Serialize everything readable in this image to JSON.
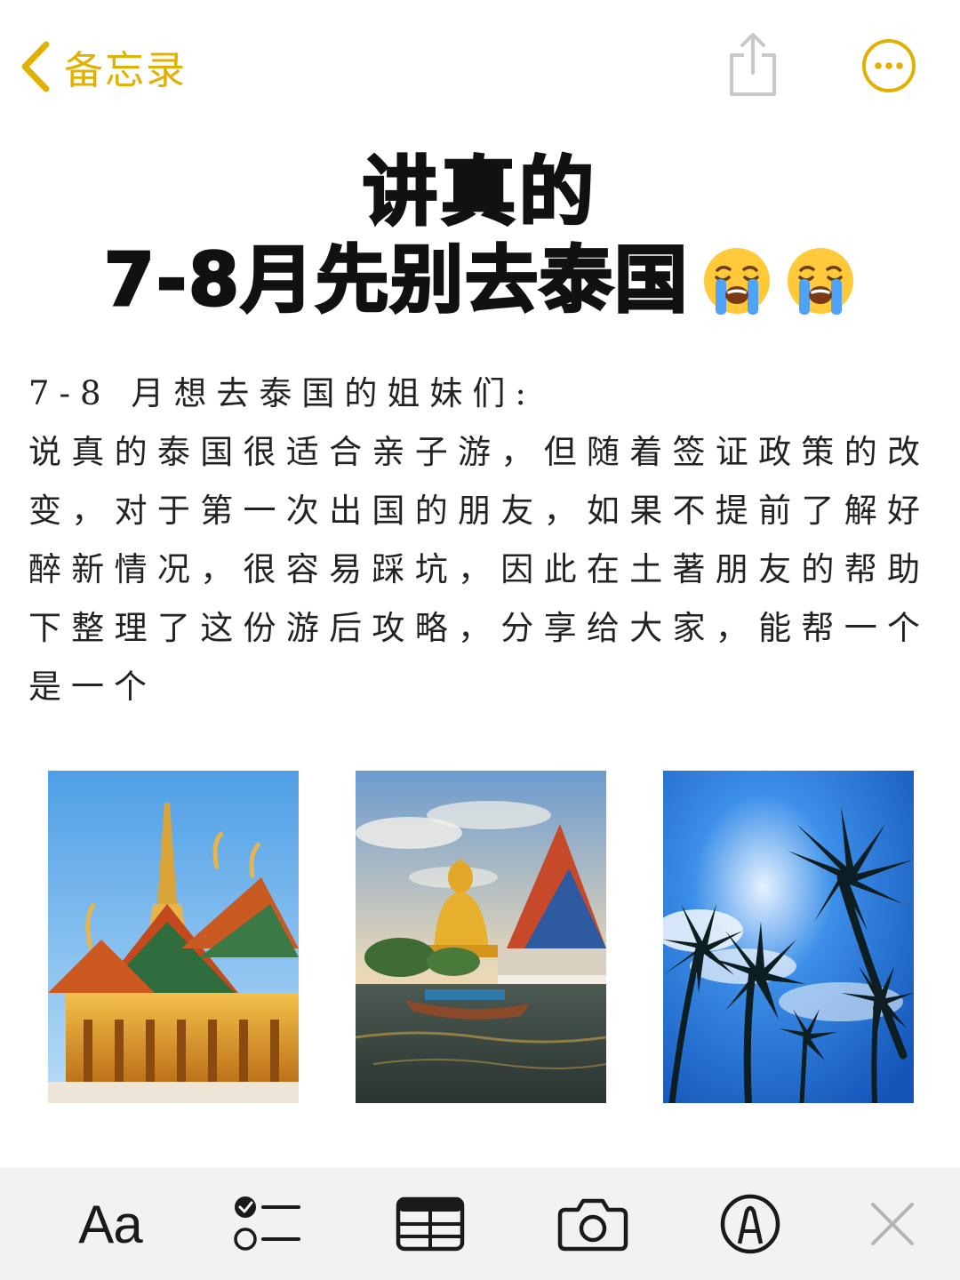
{
  "nav": {
    "back_label": "备忘录",
    "accent_color": "#E2B000"
  },
  "title": {
    "line1": "讲真的",
    "line2": "7-8月先别去泰国",
    "emoji": "loudly-crying-face"
  },
  "body": {
    "intro": "7-8 月想去泰国的姐妹们:",
    "paragraph": "说真的泰国很适合亲子游，但随着签证政策的改变，对于第一次出国的朋友，如果不提前了解好醉新情况，很容易踩坑，因此在土著朋友的帮助下整理了这份游后攻略，分享给大家，能帮一个是一个"
  },
  "photos": [
    {
      "subject": "golden-thai-temple"
    },
    {
      "subject": "big-buddha-and-canal-boat"
    },
    {
      "subject": "palm-trees-blue-sky"
    }
  ],
  "toolbar": {
    "format_label": "Aa",
    "items": [
      "format-icon",
      "checklist-icon",
      "table-icon",
      "camera-icon",
      "markup-icon",
      "close-icon"
    ]
  }
}
